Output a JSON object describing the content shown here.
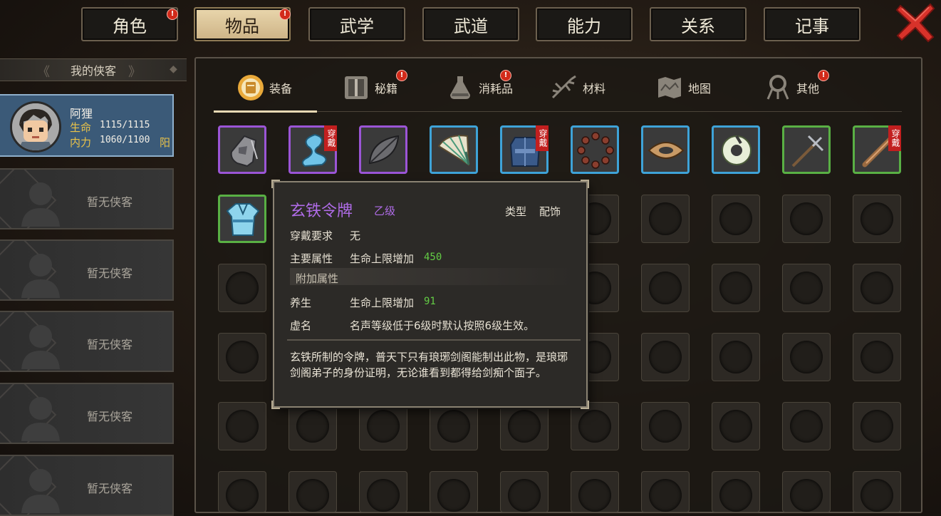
{
  "tabs": [
    {
      "label": "角色",
      "badge": true,
      "active": false
    },
    {
      "label": "物品",
      "badge": true,
      "active": true
    },
    {
      "label": "武学",
      "badge": false,
      "active": false
    },
    {
      "label": "武道",
      "badge": false,
      "active": false
    },
    {
      "label": "能力",
      "badge": false,
      "active": false
    },
    {
      "label": "关系",
      "badge": false,
      "active": false
    },
    {
      "label": "记事",
      "badge": false,
      "active": false
    }
  ],
  "badge_mark": "!",
  "sidebar": {
    "header": "我的侠客",
    "hero": {
      "name": "阿狸",
      "hp_label": "生命",
      "hp_value": "1115/1115",
      "mp_label": "内力",
      "mp_value": "1060/1100",
      "mp_type": "阳"
    },
    "empty_label": "暂无侠客"
  },
  "categories": [
    {
      "label": "装备",
      "icon": "equipment-icon",
      "badge": false,
      "active": true
    },
    {
      "label": "秘籍",
      "icon": "book-icon",
      "badge": true,
      "active": false
    },
    {
      "label": "消耗品",
      "icon": "potion-icon",
      "badge": true,
      "active": false
    },
    {
      "label": "材料",
      "icon": "herb-icon",
      "badge": false,
      "active": false
    },
    {
      "label": "地图",
      "icon": "map-icon",
      "badge": false,
      "active": false
    },
    {
      "label": "其他",
      "icon": "misc-icon",
      "badge": true,
      "active": false
    }
  ],
  "worn_label": "穿戴",
  "items": [
    {
      "icon": "token-icon",
      "rarity": "purple",
      "worn": false
    },
    {
      "icon": "sash-icon",
      "rarity": "purple",
      "worn": true
    },
    {
      "icon": "leaf-blade-icon",
      "rarity": "purple",
      "worn": false
    },
    {
      "icon": "fan-icon",
      "rarity": "blue",
      "worn": false
    },
    {
      "icon": "armor-icon",
      "rarity": "blue",
      "worn": true
    },
    {
      "icon": "beads-icon",
      "rarity": "blue",
      "worn": false
    },
    {
      "icon": "bracer-icon",
      "rarity": "blue",
      "worn": false
    },
    {
      "icon": "jade-ring-icon",
      "rarity": "blue",
      "worn": false
    },
    {
      "icon": "trident-icon",
      "rarity": "green",
      "worn": false
    },
    {
      "icon": "staff-icon",
      "rarity": "green",
      "worn": true
    },
    {
      "icon": "robe-icon",
      "rarity": "green",
      "worn": false
    }
  ],
  "colors": {
    "purple": "#9b55d6",
    "blue": "#3ea3d8",
    "green": "#59b044",
    "badge_red": "#d22a1a",
    "item_name": "#b06ce8",
    "stat_green": "#63cc45"
  },
  "tooltip": {
    "name": "玄铁令牌",
    "grade": "乙级",
    "type_label": "类型",
    "type_value": "配饰",
    "req_label": "穿戴要求",
    "req_value": "无",
    "main_label": "主要属性",
    "main_text": "生命上限增加",
    "main_value": "450",
    "extra_header": "附加属性",
    "extra1_label": "养生",
    "extra1_text": "生命上限增加",
    "extra1_value": "91",
    "extra2_label": "虚名",
    "extra2_text": "名声等级低于6级时默认按照6级生效。",
    "description": "玄铁所制的令牌，普天下只有琅琊剑阁能制出此物，是琅琊剑阁弟子的身份证明，无论谁看到都得给剑痴个面子。"
  }
}
